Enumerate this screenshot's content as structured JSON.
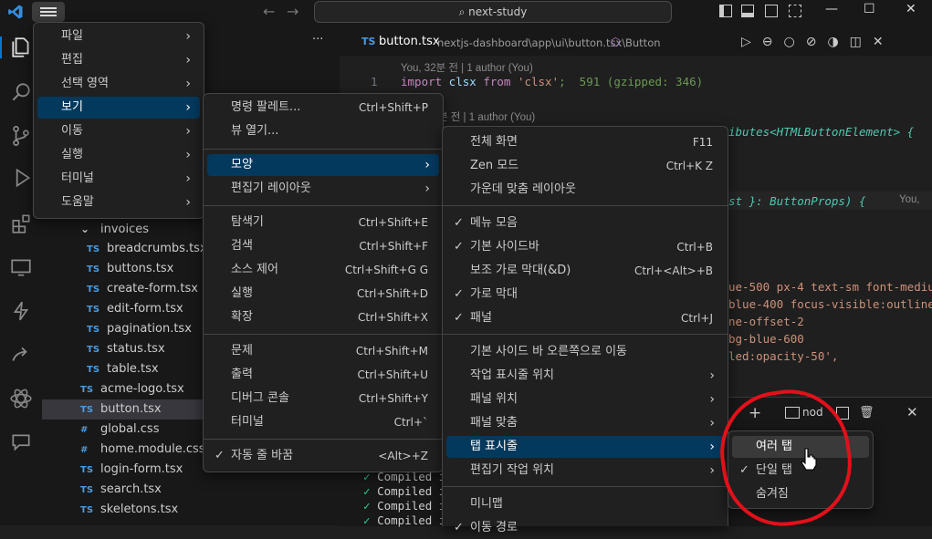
{
  "titlebar": {
    "search_text": "next-study",
    "back": "←",
    "forward": "→",
    "min": "—",
    "max": "☐",
    "close": "✕",
    "icons": [
      "vscode-logo",
      "menu-icon",
      "layout-sidebar-icon",
      "layout-panel-icon",
      "layout-secondary-icon",
      "customize-layout-icon"
    ]
  },
  "activity": [
    "explorer-icon",
    "search-icon",
    "source-control-icon",
    "run-debug-icon",
    "extensions-icon",
    "remote-explorer-icon",
    "testing-icon",
    "git-share-icon",
    "react-icon",
    "comments-icon"
  ],
  "sidebar": {
    "more": "···",
    "tree": [
      {
        "label": "invoices",
        "icon": "⌄",
        "indent": 1
      },
      {
        "label": "breadcrumbs.tsx",
        "icon": "TS",
        "indent": 2
      },
      {
        "label": "buttons.tsx",
        "icon": "TS",
        "indent": 2
      },
      {
        "label": "create-form.tsx",
        "icon": "TS",
        "indent": 2
      },
      {
        "label": "edit-form.tsx",
        "icon": "TS",
        "indent": 2
      },
      {
        "label": "pagination.tsx",
        "icon": "TS",
        "indent": 2
      },
      {
        "label": "status.tsx",
        "icon": "TS",
        "indent": 2
      },
      {
        "label": "table.tsx",
        "icon": "TS",
        "indent": 2
      },
      {
        "label": "acme-logo.tsx",
        "icon": "TS",
        "indent": 1
      },
      {
        "label": "button.tsx",
        "icon": "TS",
        "indent": 1,
        "selected": true
      },
      {
        "label": "global.css",
        "icon": "#",
        "indent": 1
      },
      {
        "label": "home.module.css",
        "icon": "#",
        "indent": 1
      },
      {
        "label": "login-form.tsx",
        "icon": "TS",
        "indent": 1
      },
      {
        "label": "search.tsx",
        "icon": "TS",
        "indent": 1
      },
      {
        "label": "skeletons.tsx",
        "icon": "TS",
        "indent": 1
      }
    ]
  },
  "editor": {
    "tab_ts": "TS",
    "tab_name": "button.tsx",
    "breadcrumb": "nextjs-dashboard\\app\\ui\\button.tsx\\",
    "breadcrumb_symbol": "Button",
    "blame1": "You, 32분 전 | 1 author (You)",
    "line_no": "1",
    "line1_import": "import",
    "line1_clsx": " clsx ",
    "line1_from": "from",
    "line1_str": " 'clsx'",
    "line1_rest": ";  591 (gzipped: 346)",
    "blame2": "분 전 | 1 author (You)",
    "frag1": "ibutes<HTMLButtonElement> {",
    "frag2": "st }: ButtonProps) {",
    "frag2_ghost": "You,",
    "frag3": "ue-500 px-4 text-sm font-medium",
    "frag4": "blue-400 focus-visible:outline",
    "frag5": "ne-offset-2",
    "frag6": "bg-blue-600",
    "frag7": "led:opacity-50',",
    "terminal_lines": [
      "Compiled i",
      "Compiled i",
      "Compiled i",
      "Compiled i"
    ],
    "terminal_label": "nod",
    "panel_add": "+",
    "panel_close": "✕"
  },
  "menu_main": [
    {
      "label": "파일"
    },
    {
      "label": "편집"
    },
    {
      "label": "선택 영역"
    },
    {
      "label": "보기",
      "active": true
    },
    {
      "label": "이동"
    },
    {
      "label": "실행"
    },
    {
      "label": "터미널"
    },
    {
      "label": "도움말"
    }
  ],
  "menu_view": {
    "items": [
      {
        "label": "명령 팔레트...",
        "key": "Ctrl+Shift+P"
      },
      {
        "label": "뷰 열기...",
        "key": ""
      },
      {
        "label": "모양",
        "key": "",
        "submenu": true,
        "active": true
      },
      {
        "label": "편집기 레이아웃",
        "key": "",
        "submenu": true
      },
      {
        "label": "탐색기",
        "key": "Ctrl+Shift+E"
      },
      {
        "label": "검색",
        "key": "Ctrl+Shift+F"
      },
      {
        "label": "소스 제어",
        "key": "Ctrl+Shift+G G"
      },
      {
        "label": "실행",
        "key": "Ctrl+Shift+D"
      },
      {
        "label": "확장",
        "key": "Ctrl+Shift+X"
      },
      {
        "label": "문제",
        "key": "Ctrl+Shift+M"
      },
      {
        "label": "출력",
        "key": "Ctrl+Shift+U"
      },
      {
        "label": "디버그 콘솔",
        "key": "Ctrl+Shift+Y"
      },
      {
        "label": "터미널",
        "key": "Ctrl+`"
      },
      {
        "label": "자동 줄 바꿈",
        "key": "<Alt>+Z",
        "checked": true
      }
    ]
  },
  "menu_appearance": {
    "items": [
      {
        "label": "전체 화면",
        "key": "F11"
      },
      {
        "label": "Zen 모드",
        "key": "Ctrl+K Z"
      },
      {
        "label": "가운데 맞춤 레이아웃",
        "key": ""
      },
      {
        "label": "메뉴 모음",
        "key": "",
        "checked": true
      },
      {
        "label": "기본 사이드바",
        "key": "Ctrl+B",
        "checked": true
      },
      {
        "label": "보조 가로 막대(&D)",
        "key": "Ctrl+<Alt>+B"
      },
      {
        "label": "가로 막대",
        "key": "",
        "checked": true
      },
      {
        "label": "패널",
        "key": "Ctrl+J",
        "checked": true
      },
      {
        "label": "기본 사이드 바 오른쪽으로 이동",
        "key": ""
      },
      {
        "label": "작업 표시줄 위치",
        "key": "",
        "submenu": true
      },
      {
        "label": "패널 위치",
        "key": "",
        "submenu": true
      },
      {
        "label": "패널 맞춤",
        "key": "",
        "submenu": true
      },
      {
        "label": "탭 표시줄",
        "key": "",
        "submenu": true,
        "active": true
      },
      {
        "label": "편집기 작업 위치",
        "key": "",
        "submenu": true
      },
      {
        "label": "미니맵",
        "key": ""
      },
      {
        "label": "이동 경로",
        "key": "",
        "checked": true
      }
    ]
  },
  "menu_tabs": {
    "items": [
      {
        "label": "여러 탭",
        "active": true
      },
      {
        "label": "단일 탭",
        "checked": true
      },
      {
        "label": "숨겨짐"
      }
    ]
  },
  "colors": {
    "accent": "#04395e",
    "annotation": "#e3101a",
    "ts_blue": "#4b9be0"
  }
}
